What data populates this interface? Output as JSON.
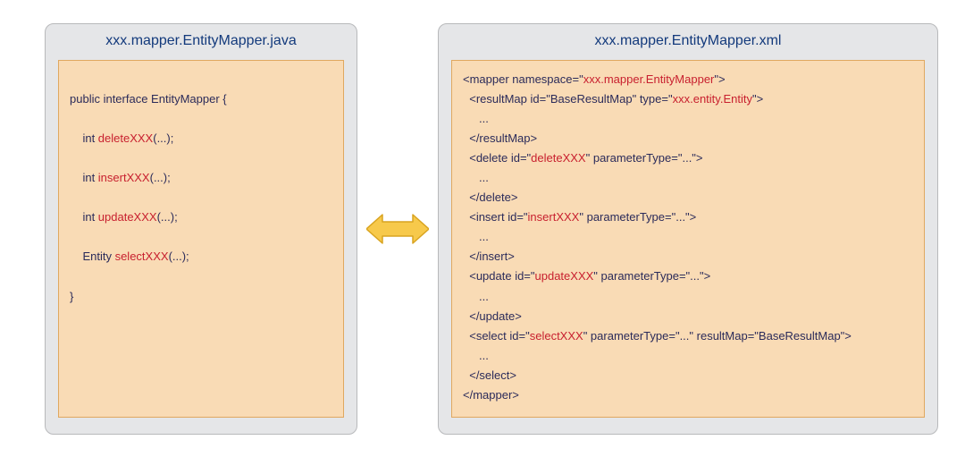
{
  "left": {
    "title": "xxx.mapper.EntityMapper.java",
    "code": {
      "decl_prefix": "public interface EntityMapper {",
      "m1_prefix": "    int ",
      "m1_name": "deleteXXX",
      "m1_suffix": "(...);",
      "m2_prefix": "    int ",
      "m2_name": "insertXXX",
      "m2_suffix": "(...);",
      "m3_prefix": "    int ",
      "m3_name": "updateXXX",
      "m3_suffix": "(...);",
      "m4_prefix": "    Entity ",
      "m4_name": "selectXXX",
      "m4_suffix": "(...);",
      "close": "}"
    }
  },
  "right": {
    "title": "xxx.mapper.EntityMapper.xml",
    "code": {
      "l1a": "<mapper namespace=\"",
      "l1b": "xxx.mapper.EntityMapper",
      "l1c": "\">",
      "l2a": "  <resultMap id=\"BaseResultMap\" type=\"",
      "l2b": "xxx.entity.Entity",
      "l2c": "\">",
      "l3": "     ...",
      "l4": "  </resultMap>",
      "l5a": "  <delete id=\"",
      "l5b": "deleteXXX",
      "l5c": "\" parameterType=\"...\">",
      "l6": "     ...",
      "l7": "  </delete>",
      "l8a": "  <insert id=\"",
      "l8b": "insertXXX",
      "l8c": "\" parameterType=\"...\">",
      "l9": "     ...",
      "l10": "  </insert>",
      "l11a": "  <update id=\"",
      "l11b": "updateXXX",
      "l11c": "\" parameterType=\"...\">",
      "l12": "     ...",
      "l13": "  </update>",
      "l14a": "  <select id=\"",
      "l14b": "selectXXX",
      "l14c": "\" parameterType=\"...\" resultMap=\"BaseResultMap\">",
      "l15": "     ...",
      "l16": "  </select>",
      "l17": "</mapper>"
    }
  }
}
